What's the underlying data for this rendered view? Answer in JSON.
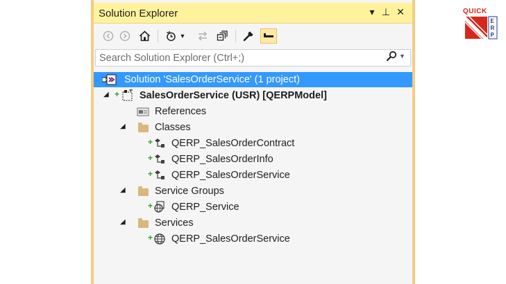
{
  "panel": {
    "title": "Solution Explorer",
    "controls": [
      "▾",
      "⊥",
      "✕"
    ]
  },
  "toolbar": {
    "buttons": [
      "back-icon",
      "forward-icon",
      "home-icon",
      "history-icon",
      "sync-icon",
      "collapse-all-icon",
      "properties-icon",
      "preview-icon"
    ]
  },
  "search": {
    "placeholder": "Search Solution Explorer (Ctrl+;)"
  },
  "tree": {
    "solution": "Solution 'SalesOrderService' (1 project)",
    "project": "SalesOrderService (USR) [QERPModel]",
    "references": "References",
    "classes": "Classes",
    "class_items": [
      "QERP_SalesOrderContract",
      "QERP_SalesOrderInfo",
      "QERP_SalesOrderService"
    ],
    "service_groups": "Service Groups",
    "service_group_items": [
      "QERP_Service"
    ],
    "services": "Services",
    "service_items": [
      "QERP_SalesOrderService"
    ]
  },
  "logo": {
    "text_top": "QUICK",
    "text_side": "ERP"
  },
  "colors": {
    "title_bar": "#fff29d",
    "frame": "#f5cc84",
    "selection": "#3399ff",
    "logo_red": "#d9261c",
    "logo_blue": "#1f3b8a"
  }
}
